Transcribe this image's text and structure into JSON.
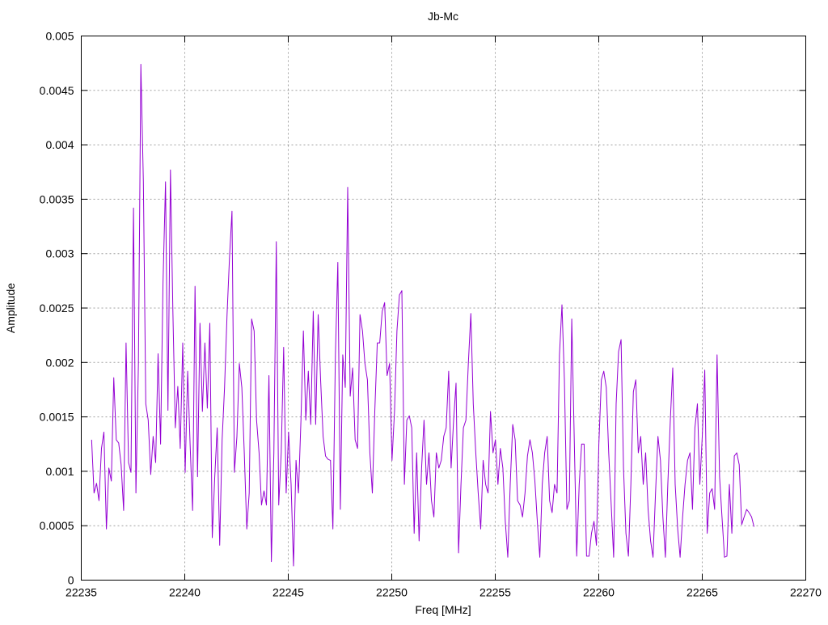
{
  "chart_data": {
    "type": "line",
    "title": "Jb-Mc",
    "xlabel": "Freq [MHz]",
    "ylabel": "Amplitude",
    "xlim": [
      22235,
      22270
    ],
    "ylim": [
      0,
      0.005
    ],
    "grid": true,
    "legend": "none",
    "x_ticks": [
      "22235",
      "22240",
      "22245",
      "22250",
      "22255",
      "22260",
      "22265",
      "22270"
    ],
    "y_ticks": [
      "0",
      "0.0005",
      "0.001",
      "0.0015",
      "0.002",
      "0.0025",
      "0.003",
      "0.0035",
      "0.004",
      "0.0045",
      "0.005"
    ],
    "series": [
      {
        "name": "Jb-Mc",
        "color": "#9400d3",
        "x_start": 22235.5,
        "x_end": 22267.5,
        "value_multiplier": 0.001,
        "values": [
          1.29,
          0.8,
          0.89,
          0.73,
          1.21,
          1.36,
          0.47,
          1.03,
          0.91,
          1.86,
          1.29,
          1.26,
          1.06,
          0.64,
          2.18,
          1.08,
          0.99,
          3.42,
          0.8,
          1.99,
          4.74,
          3.66,
          1.62,
          1.47,
          0.97,
          1.32,
          1.08,
          2.08,
          1.25,
          2.73,
          3.66,
          1.56,
          3.77,
          2.47,
          1.4,
          1.78,
          1.21,
          2.18,
          0.99,
          1.92,
          1.25,
          0.64,
          2.7,
          0.95,
          2.36,
          1.55,
          2.18,
          1.58,
          2.36,
          0.39,
          0.95,
          1.4,
          0.32,
          1.29,
          1.77,
          2.44,
          2.96,
          3.39,
          0.99,
          1.32,
          1.99,
          1.77,
          1.17,
          0.47,
          0.8,
          2.4,
          2.29,
          1.47,
          1.17,
          0.69,
          0.82,
          0.69,
          1.88,
          0.17,
          1.17,
          3.11,
          0.69,
          1.17,
          2.14,
          0.8,
          1.36,
          0.88,
          0.13,
          1.1,
          0.8,
          1.47,
          2.29,
          1.47,
          1.92,
          1.43,
          2.47,
          1.43,
          2.44,
          1.84,
          1.32,
          1.14,
          1.11,
          1.1,
          0.47,
          2.07,
          2.92,
          0.65,
          2.07,
          1.77,
          3.61,
          1.69,
          1.95,
          1.29,
          1.21,
          2.44,
          2.29,
          1.99,
          1.84,
          1.17,
          0.8,
          1.55,
          2.18,
          2.18,
          2.47,
          2.55,
          1.88,
          1.99,
          1.1,
          1.55,
          2.29,
          2.62,
          2.66,
          0.88,
          1.47,
          1.51,
          1.4,
          0.43,
          1.17,
          0.36,
          1.03,
          1.47,
          0.88,
          1.17,
          0.73,
          0.58,
          1.17,
          1.03,
          1.1,
          1.32,
          1.4,
          1.92,
          1.03,
          1.47,
          1.81,
          0.25,
          0.88,
          1.4,
          1.47,
          1.99,
          2.45,
          1.62,
          1.17,
          0.8,
          0.47,
          1.1,
          0.88,
          0.8,
          1.55,
          1.17,
          1.29,
          0.88,
          1.21,
          1.03,
          0.54,
          0.21,
          0.88,
          1.43,
          1.29,
          0.73,
          0.69,
          0.58,
          0.8,
          1.14,
          1.29,
          1.17,
          0.91,
          0.54,
          0.21,
          0.88,
          1.17,
          1.32,
          0.73,
          0.62,
          0.88,
          0.8,
          2.07,
          2.53,
          1.84,
          0.65,
          0.73,
          2.4,
          1.29,
          0.22,
          0.88,
          1.25,
          1.25,
          0.22,
          0.22,
          0.43,
          0.54,
          0.32,
          1.25,
          1.84,
          1.92,
          1.77,
          1.17,
          0.69,
          0.21,
          1.62,
          2.1,
          2.21,
          1.03,
          0.43,
          0.22,
          0.88,
          1.73,
          1.84,
          1.17,
          1.32,
          0.88,
          1.17,
          0.65,
          0.36,
          0.21,
          0.8,
          1.32,
          1.1,
          0.58,
          0.21,
          0.88,
          1.47,
          1.95,
          0.88,
          0.47,
          0.21,
          0.58,
          0.88,
          1.1,
          1.17,
          0.65,
          1.4,
          1.62,
          0.88,
          1.32,
          1.93,
          0.43,
          0.8,
          0.84,
          0.65,
          2.07,
          0.95,
          0.58,
          0.21,
          0.22,
          0.88,
          0.43,
          1.14,
          1.17,
          1.06,
          0.51,
          0.58,
          0.65,
          0.62,
          0.58,
          0.49
        ]
      }
    ]
  }
}
